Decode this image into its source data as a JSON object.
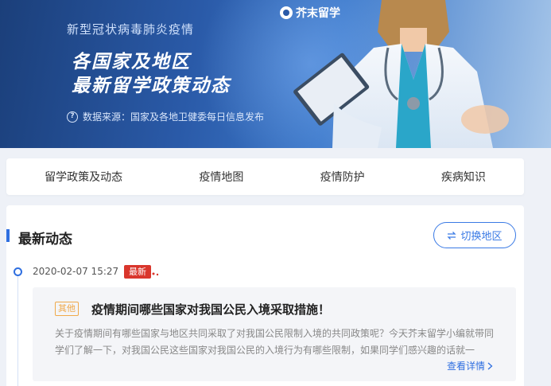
{
  "banner": {
    "logo_text": "芥末留学",
    "subtitle": "新型冠状病毒肺炎疫情",
    "title_line1": "各国家及地区",
    "title_line2": "最新留学政策动态",
    "source_text": "数据来源：国家及各地卫健委每日信息发布"
  },
  "nav": {
    "tabs": [
      "留学政策及动态",
      "疫情地图",
      "疫情防护",
      "疾病知识"
    ]
  },
  "main": {
    "section_title": "最新动态",
    "switch_label": "切换地区",
    "entry": {
      "date": "2020-02-07 15:27",
      "badge": "最新",
      "tag": "其他",
      "headline": "疫情期间哪些国家对我国公民入境采取措施！",
      "summary": "关于疫情期间有哪些国家与地区共同采取了对我国公民限制入境的共同政策呢？今天芥末留学小编就带同学们了解一下，对我国公民这些国家对我国公民的入境行为有哪些限制，如果同学们感兴趣的话就一",
      "more_label": "查看详情"
    }
  },
  "colors": {
    "accent": "#2f6fe0",
    "badge_red": "#d9362c",
    "tag_orange": "#f0a94a"
  }
}
